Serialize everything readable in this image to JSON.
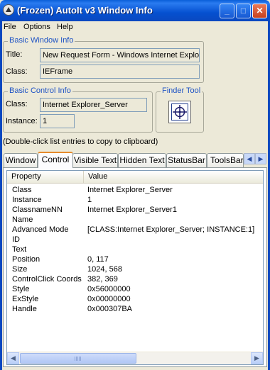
{
  "window": {
    "title": "(Frozen) AutoIt v3 Window Info",
    "buttons": {
      "minimize": "_",
      "maximize": "□",
      "close": "✕"
    }
  },
  "menu": [
    "File",
    "Options",
    "Help"
  ],
  "basic_window_info": {
    "group_title": "Basic Window Info",
    "title_label": "Title:",
    "title_value": "New Request Form - Windows Internet Explorer",
    "class_label": "Class:",
    "class_value": "IEFrame"
  },
  "basic_control_info": {
    "group_title": "Basic Control Info",
    "class_label": "Class:",
    "class_value": "Internet Explorer_Server",
    "instance_label": "Instance:",
    "instance_value": "1"
  },
  "finder_tool": {
    "group_title": "Finder Tool"
  },
  "hint": "(Double-click list entries to copy to clipboard)",
  "tabs": [
    "Window",
    "Control",
    "Visible Text",
    "Hidden Text",
    "StatusBar",
    "ToolsBar"
  ],
  "active_tab": "Control",
  "list": {
    "columns": [
      "Property",
      "Value"
    ],
    "rows": [
      {
        "property": "Class",
        "value": "Internet Explorer_Server"
      },
      {
        "property": "Instance",
        "value": "1"
      },
      {
        "property": "ClassnameNN",
        "value": "Internet Explorer_Server1"
      },
      {
        "property": "Name",
        "value": ""
      },
      {
        "property": "Advanced Mode",
        "value": "[CLASS:Internet Explorer_Server; INSTANCE:1]"
      },
      {
        "property": "ID",
        "value": ""
      },
      {
        "property": "Text",
        "value": ""
      },
      {
        "property": "Position",
        "value": "0, 117"
      },
      {
        "property": "Size",
        "value": "1024, 568"
      },
      {
        "property": "ControlClick Coords",
        "value": "382, 369"
      },
      {
        "property": "Style",
        "value": "0x56000000"
      },
      {
        "property": "ExStyle",
        "value": "0x00000000"
      },
      {
        "property": "Handle",
        "value": "0x000307BA"
      }
    ]
  },
  "colors": {
    "titlebar": "#0a5fd8",
    "group_title": "#1d52c4",
    "active_tab_accent": "#e68b2c"
  }
}
